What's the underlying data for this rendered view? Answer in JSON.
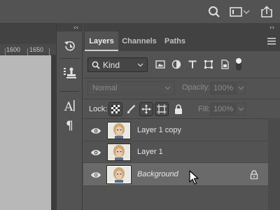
{
  "topbar": {
    "icons": [
      "search-icon",
      "workspace-icon",
      "chevron-down-icon",
      "share-icon"
    ]
  },
  "document": {
    "ruler_labels": [
      "1600",
      "1650"
    ]
  },
  "tools": {
    "icons": [
      "history-icon",
      "clone-source-icon",
      "character-icon",
      "paragraph-icon"
    ]
  },
  "panel": {
    "tabs": [
      {
        "label": "Layers",
        "active": true
      },
      {
        "label": "Channels",
        "active": false
      },
      {
        "label": "Paths",
        "active": false
      }
    ],
    "filter": {
      "kind_label": "Kind",
      "icons": [
        "image-filter-icon",
        "adjustment-filter-icon",
        "type-filter-icon",
        "shape-filter-icon",
        "smartobject-filter-icon",
        "filter-toggle-icon"
      ]
    },
    "blend": {
      "mode": "Normal",
      "opacity_label": "Opacity:",
      "opacity_value": "100%"
    },
    "lock": {
      "label": "Lock:",
      "fill_label": "Fill:",
      "fill_value": "100%",
      "icons": [
        "lock-transparent-icon",
        "lock-image-icon",
        "lock-position-icon",
        "lock-artboard-icon",
        "lock-all-icon"
      ]
    },
    "layers": [
      {
        "name": "Layer 1 copy",
        "visible": true,
        "selected": false,
        "locked": false,
        "italic": false
      },
      {
        "name": "Layer 1",
        "visible": true,
        "selected": false,
        "locked": false,
        "italic": false
      },
      {
        "name": "Background",
        "visible": true,
        "selected": true,
        "locked": true,
        "italic": true
      }
    ]
  },
  "colors": {
    "app_bg": "#535353",
    "panel_dark": "#424242",
    "selected_row": "#6a6a6a",
    "text": "#e6e6e6"
  }
}
